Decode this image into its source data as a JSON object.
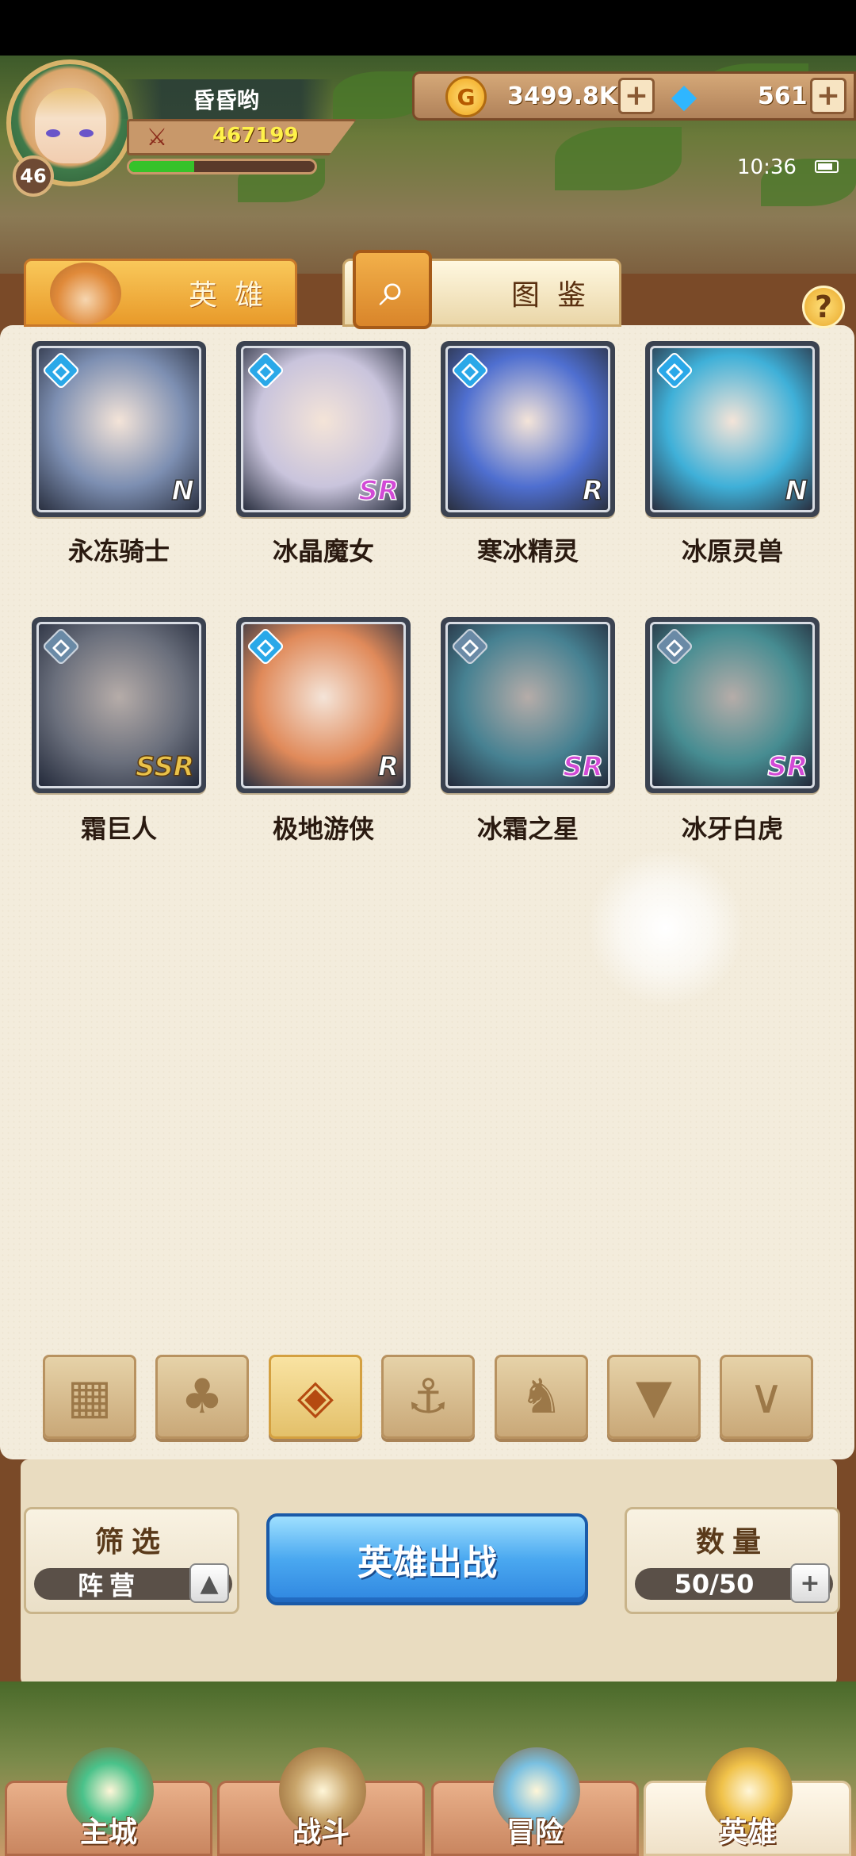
{
  "player": {
    "name": "昏昏哟",
    "level": "46",
    "power": "467199",
    "exp_fraction": 0.35
  },
  "currency": {
    "gold": "3499.8K",
    "gems": "561"
  },
  "status": {
    "time": "10:36"
  },
  "tabs": [
    {
      "label": "英雄",
      "icon": "hero-helmet-icon",
      "active": false
    },
    {
      "label": "图鉴",
      "icon": "magnifier-icon",
      "active": true
    }
  ],
  "heroes": [
    {
      "name": "永冻骑士",
      "rarity": "N",
      "color": "#7d8fb2"
    },
    {
      "name": "冰晶魔女",
      "rarity": "SR",
      "color": "#c9c4dc"
    },
    {
      "name": "寒冰精灵",
      "rarity": "R",
      "color": "#4f6fd0"
    },
    {
      "name": "冰原灵兽",
      "rarity": "N",
      "color": "#3fb0d8"
    },
    {
      "name": "霜巨人",
      "rarity": "SSR",
      "color": "#8b8f9a"
    },
    {
      "name": "极地游侠",
      "rarity": "R",
      "color": "#e08a5a"
    },
    {
      "name": "冰霜之星",
      "rarity": "SR",
      "color": "#5aa8b8"
    },
    {
      "name": "冰牙白虎",
      "rarity": "SR",
      "color": "#5ab8b8"
    }
  ],
  "filter_icons": [
    "all-grid-icon",
    "leaf-icon",
    "ice-faction-icon",
    "anchor-icon",
    "beast-icon",
    "demon-icon",
    "horn-icon"
  ],
  "controls": {
    "filter_title": "筛选",
    "filter_value": "阵营",
    "deploy_label": "英雄出战",
    "count_title": "数量",
    "count_value": "50/50"
  },
  "nav": [
    {
      "label": "主城",
      "icon": "city-icon",
      "active": false
    },
    {
      "label": "战斗",
      "icon": "crossed-swords-icon",
      "active": false
    },
    {
      "label": "冒险",
      "icon": "scroll-map-icon",
      "active": false
    },
    {
      "label": "英雄",
      "icon": "hero-crest-icon",
      "active": true
    }
  ]
}
